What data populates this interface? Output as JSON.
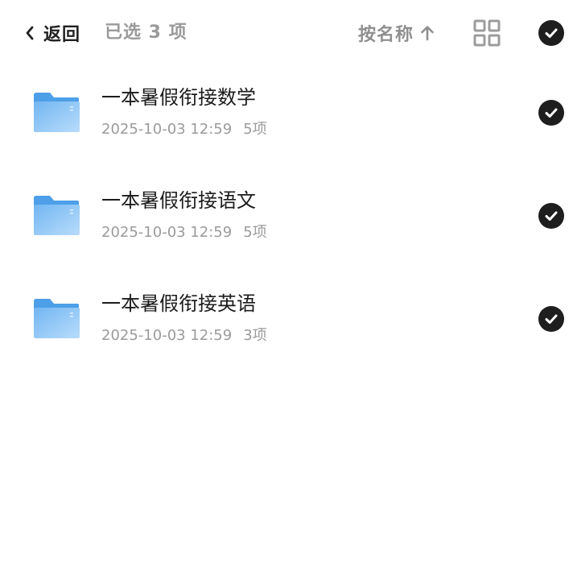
{
  "header": {
    "back_label": "返回",
    "selected_text": "已选 3 项",
    "sort_label": "按名称",
    "icons": {
      "back": "chevron-left-icon",
      "sort_direction": "arrow-up-icon",
      "view_toggle": "grid-view-icon",
      "select_all": "check-circle-icon"
    }
  },
  "files": [
    {
      "name": "一本暑假衔接数学",
      "date": "2025-10-03 12:59",
      "count": "5项",
      "selected": true
    },
    {
      "name": "一本暑假衔接语文",
      "date": "2025-10-03 12:59",
      "count": "5项",
      "selected": true
    },
    {
      "name": "一本暑假衔接英语",
      "date": "2025-10-03 12:59",
      "count": "3项",
      "selected": true
    }
  ],
  "colors": {
    "folder_blue": "#5aa9ef",
    "folder_light": "#a9d3fa",
    "check_bg": "#1e1e1e",
    "muted_text": "#9a9a9a"
  }
}
